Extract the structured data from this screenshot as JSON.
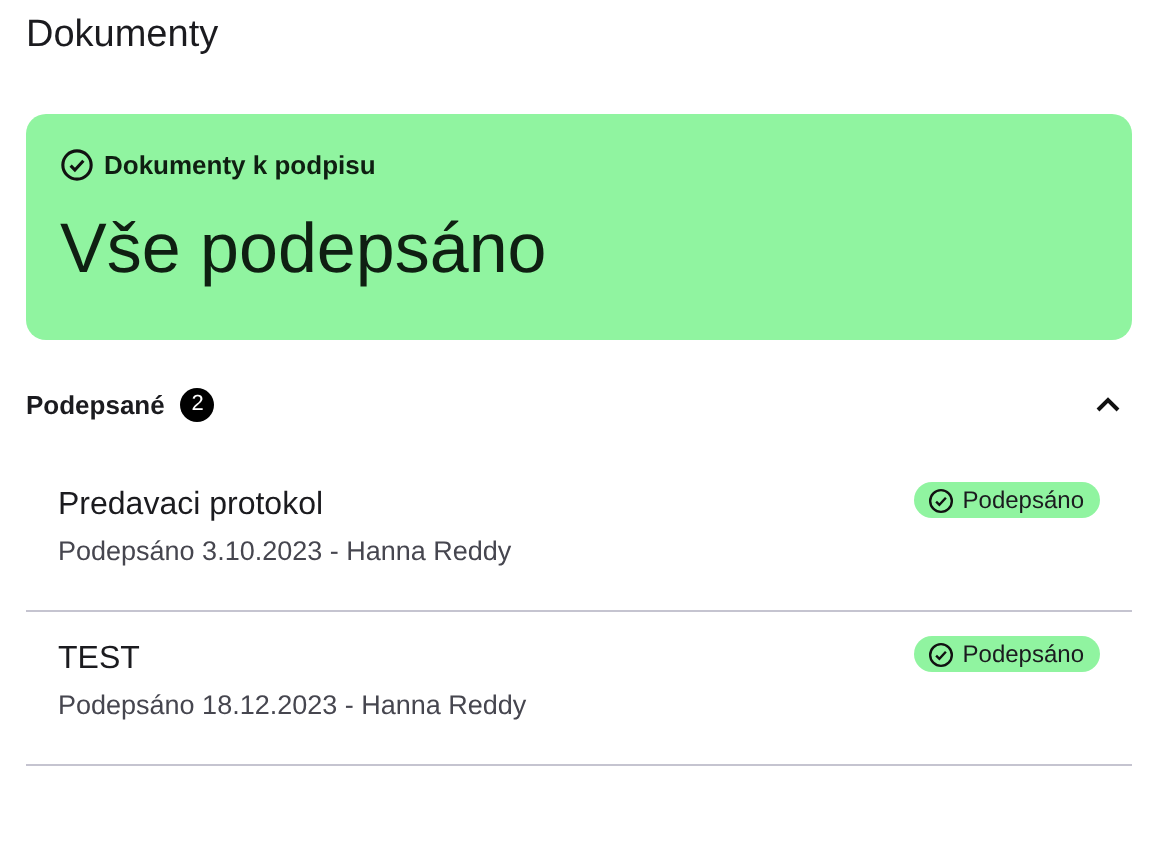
{
  "page_title": "Dokumenty",
  "summary_card": {
    "label": "Dokumenty k podpisu",
    "headline": "Vše podepsáno"
  },
  "section": {
    "title": "Podepsané",
    "count": "2",
    "expanded": true,
    "documents": [
      {
        "name": "Predavaci protokol",
        "detail": "Podepsáno 3.10.2023 - Hanna Reddy",
        "status": "Podepsáno"
      },
      {
        "name": "TEST",
        "detail": "Podepsáno 18.12.2023 - Hanna Reddy",
        "status": "Podepsáno"
      }
    ]
  }
}
